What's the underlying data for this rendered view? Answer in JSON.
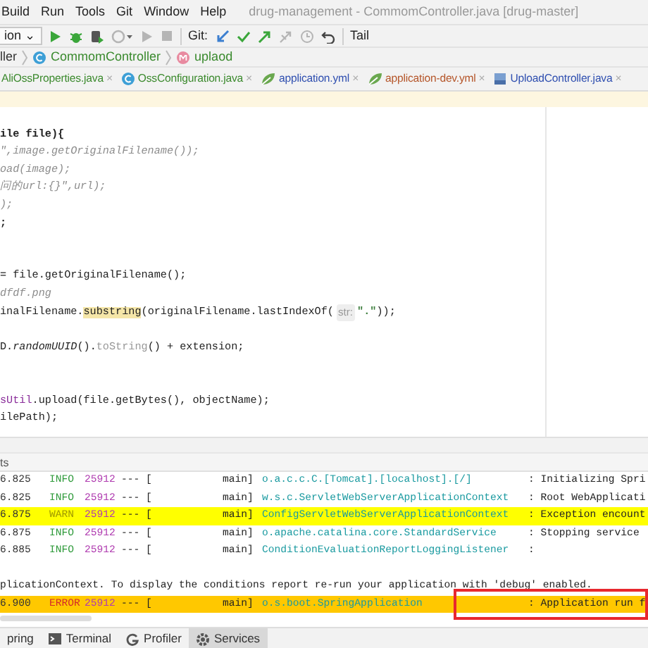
{
  "menu": [
    "Build",
    "Run",
    "Tools",
    "Git",
    "Window",
    "Help"
  ],
  "window_title": "drug-management - CommomController.java [drug-master]",
  "toolbar": {
    "run_config": "ion",
    "caret": "⌄",
    "actions": [
      {
        "kind": "run",
        "disabled": false
      },
      {
        "kind": "debug",
        "disabled": false
      },
      {
        "kind": "coverage",
        "disabled": false
      },
      {
        "kind": "profile",
        "disabled": true
      },
      {
        "kind": "play",
        "disabled": true
      },
      {
        "kind": "stop",
        "disabled": true
      }
    ],
    "git_label": "Git:",
    "git_actions": [
      {
        "kind": "update",
        "disabled": false
      },
      {
        "kind": "commit",
        "disabled": false
      },
      {
        "kind": "push",
        "disabled": false
      },
      {
        "kind": "merge",
        "disabled": true
      },
      {
        "kind": "history",
        "disabled": true
      },
      {
        "kind": "rollback",
        "disabled": false
      }
    ],
    "tail": "Tail"
  },
  "breadcrumb": [
    {
      "text": "ller",
      "kind": "plain"
    },
    {
      "text": "CommomController",
      "kind": "class"
    },
    {
      "text": "uplaod",
      "kind": "method"
    }
  ],
  "tabs": [
    {
      "label": "AliOssProperties.java",
      "kind": "none",
      "color": "#3c8a2e",
      "close": "×"
    },
    {
      "label": "OssConfiguration.java",
      "kind": "class",
      "color": "#3c8a2e",
      "close": "×"
    },
    {
      "label": "application.yml",
      "kind": "yml",
      "color": "#2f4fb0",
      "close": "×"
    },
    {
      "label": "application-dev.yml",
      "kind": "yml",
      "color": "#b5562a",
      "close": "×"
    },
    {
      "label": "UploadController.java",
      "kind": "java",
      "color": "#2f4fb0",
      "close": "×"
    }
  ],
  "editor": {
    "lines": [
      {
        "kind": "blank"
      },
      {
        "kind": "code",
        "segments": [
          {
            "text": "ile file){",
            "kind": "bold"
          }
        ]
      },
      {
        "kind": "code",
        "segments": [
          {
            "text": "\",image.getOriginalFilename());",
            "kind": "comment"
          }
        ]
      },
      {
        "kind": "code",
        "segments": [
          {
            "text": "oad(image);",
            "kind": "comment"
          }
        ]
      },
      {
        "kind": "code",
        "segments": [
          {
            "text": "问的url:{}\",url);",
            "kind": "comment"
          }
        ]
      },
      {
        "kind": "code",
        "segments": [
          {
            "text": ");",
            "kind": "comment"
          }
        ]
      },
      {
        "kind": "code",
        "segments": [
          {
            "text": ";",
            "kind": "bold"
          }
        ]
      },
      {
        "kind": "blank"
      },
      {
        "kind": "blank"
      },
      {
        "kind": "code",
        "segments": [
          {
            "text": "= file.getOriginalFilename();",
            "kind": "normal"
          }
        ]
      },
      {
        "kind": "code",
        "segments": [
          {
            "text": "dfdf.png",
            "kind": "comment"
          }
        ]
      },
      {
        "kind": "code",
        "segments": [
          {
            "text": "inalFilename.",
            "kind": "normal"
          },
          {
            "text": "substring",
            "kind": "highlight"
          },
          {
            "text": "(originalFilename.lastIndexOf(",
            "kind": "normal"
          },
          {
            "text": "str:",
            "kind": "hint"
          },
          {
            "text": "\".\"",
            "kind": "string"
          },
          {
            "text": "));",
            "kind": "normal"
          }
        ]
      },
      {
        "kind": "blank"
      },
      {
        "kind": "code",
        "segments": [
          {
            "text": "D.",
            "kind": "normal"
          },
          {
            "text": "randomUUID",
            "kind": "italic"
          },
          {
            "text": "().",
            "kind": "normal"
          },
          {
            "text": "toString",
            "kind": "muted"
          },
          {
            "text": "() + extension;",
            "kind": "normal"
          }
        ]
      },
      {
        "kind": "blank"
      },
      {
        "kind": "blank"
      },
      {
        "kind": "code",
        "segments": [
          {
            "text": "sUtil",
            "kind": "purple"
          },
          {
            "text": ".upload(file.getBytes(), objectName);",
            "kind": "normal"
          }
        ]
      },
      {
        "kind": "code",
        "segments": [
          {
            "text": "ilePath);",
            "kind": "normal"
          }
        ]
      }
    ]
  },
  "console": {
    "header": "ts",
    "rows": [
      {
        "kind": "log",
        "time": "6.825",
        "level": "INFO",
        "pid": "25912",
        "sep": "--- [",
        "thread": "main]",
        "logger": "o.a.c.c.C.[Tomcat].[localhost].[/]",
        "message": ": Initializing Spri",
        "framed": false
      },
      {
        "kind": "log",
        "time": "6.825",
        "level": "INFO",
        "pid": "25912",
        "sep": "--- [",
        "thread": "main]",
        "logger": "w.s.c.ServletWebServerApplicationContext",
        "message": ": Root WebApplicati",
        "framed": false
      },
      {
        "kind": "log",
        "time": "6.875",
        "level": "WARN",
        "pid": "25912",
        "sep": "--- [",
        "thread": "main]",
        "logger": "ConfigServletWebServerApplicationContext",
        "message": ": Exception encount",
        "framed": false
      },
      {
        "kind": "log",
        "time": "6.875",
        "level": "INFO",
        "pid": "25912",
        "sep": "--- [",
        "thread": "main]",
        "logger": "o.apache.catalina.core.StandardService",
        "message": ": Stopping service",
        "framed": false
      },
      {
        "kind": "log",
        "time": "6.885",
        "level": "INFO",
        "pid": "25912",
        "sep": "--- [",
        "thread": "main]",
        "logger": "ConditionEvaluationReportLoggingListener",
        "message": ":",
        "framed": false
      },
      {
        "kind": "blank"
      },
      {
        "kind": "plain",
        "text": "plicationContext. To display the conditions report re-run your application with 'debug' enabled."
      },
      {
        "kind": "log",
        "time": "6.900",
        "level": "ERROR",
        "pid": "25912",
        "sep": "--- [",
        "thread": "main]",
        "logger": "o.s.boot.SpringApplication",
        "message": ": Application run f",
        "framed": true
      }
    ]
  },
  "tool_tabs": [
    {
      "label": "pring",
      "kind": "plain",
      "selected": false
    },
    {
      "label": "Terminal",
      "kind": "terminal",
      "selected": false
    },
    {
      "label": "Profiler",
      "kind": "profiler",
      "selected": false
    },
    {
      "label": "Services",
      "kind": "services",
      "selected": true
    }
  ]
}
